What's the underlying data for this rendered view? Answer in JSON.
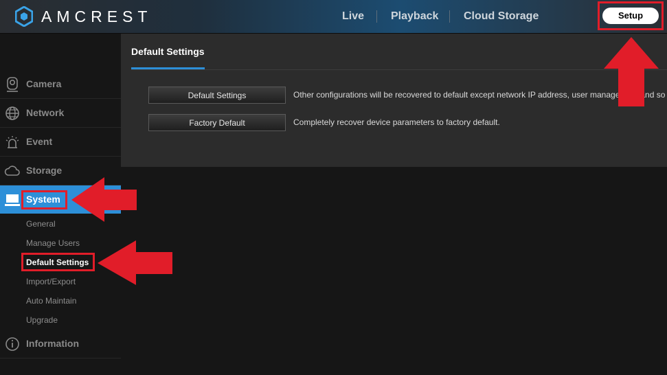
{
  "header": {
    "brand": "AMCREST",
    "nav": [
      "Live",
      "Playback",
      "Cloud Storage"
    ],
    "setup_label": "Setup"
  },
  "sidebar": {
    "items": [
      {
        "label": "Camera",
        "icon": "camera-icon"
      },
      {
        "label": "Network",
        "icon": "globe-icon"
      },
      {
        "label": "Event",
        "icon": "alarm-icon"
      },
      {
        "label": "Storage",
        "icon": "cloud-icon"
      },
      {
        "label": "System",
        "icon": "monitor-icon",
        "active": true
      }
    ],
    "subitems": [
      "General",
      "Manage Users",
      "Default Settings",
      "Import/Export",
      "Auto Maintain",
      "Upgrade"
    ],
    "active_subitem": "Default Settings",
    "information": {
      "label": "Information",
      "icon": "info-icon"
    }
  },
  "panel": {
    "title": "Default Settings",
    "rows": [
      {
        "button": "Default Settings",
        "description": "Other configurations will be recovered to default except network IP address, user management and so"
      },
      {
        "button": "Factory Default",
        "description": "Completely recover device parameters to factory default."
      }
    ]
  },
  "colors": {
    "accent": "#2d8fd8",
    "annotation": "#e11d29"
  }
}
